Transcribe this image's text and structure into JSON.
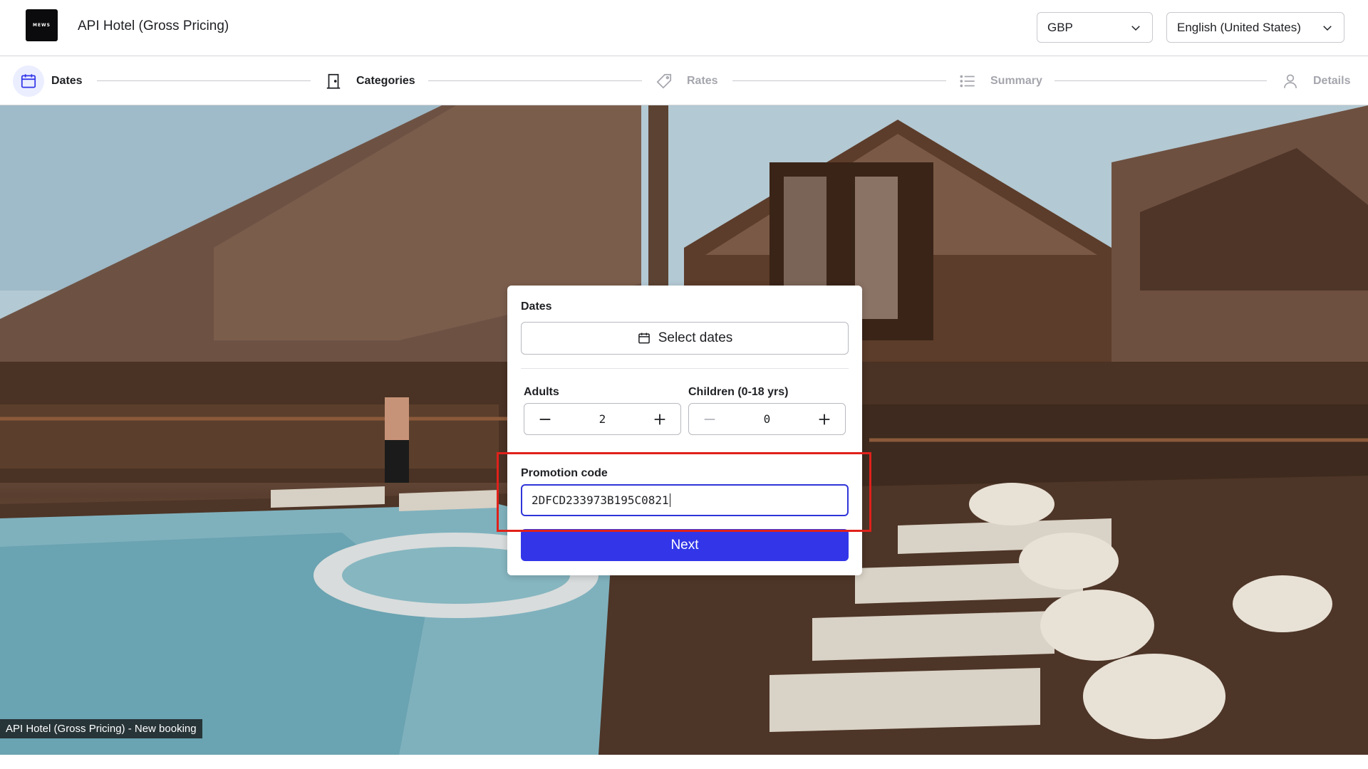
{
  "header": {
    "logo_text": "MEWS",
    "hotel_name": "API Hotel (Gross Pricing)",
    "currency": {
      "value": "GBP",
      "icon": "chevron-down-icon"
    },
    "language": {
      "value": "English (United States)",
      "icon": "chevron-down-icon"
    }
  },
  "steps": [
    {
      "label": "Dates",
      "icon": "calendar-icon",
      "state": "active"
    },
    {
      "label": "Categories",
      "icon": "door-icon",
      "state": "done"
    },
    {
      "label": "Rates",
      "icon": "tag-icon",
      "state": "todo"
    },
    {
      "label": "Summary",
      "icon": "list-icon",
      "state": "todo"
    },
    {
      "label": "Details",
      "icon": "user-icon",
      "state": "todo"
    }
  ],
  "booking": {
    "dates_label": "Dates",
    "select_dates": "Select dates",
    "adults_label": "Adults",
    "adults_value": "2",
    "children_label": "Children (0-18 yrs)",
    "children_value": "0",
    "promo_label": "Promotion code",
    "promo_value": "2DFCD233973B195C0821",
    "next_label": "Next"
  },
  "caption": "API Hotel (Gross Pricing) - New booking",
  "colors": {
    "accent": "#3236e8",
    "highlight": "#e0211b",
    "active_step_bg": "#ebeeff"
  }
}
